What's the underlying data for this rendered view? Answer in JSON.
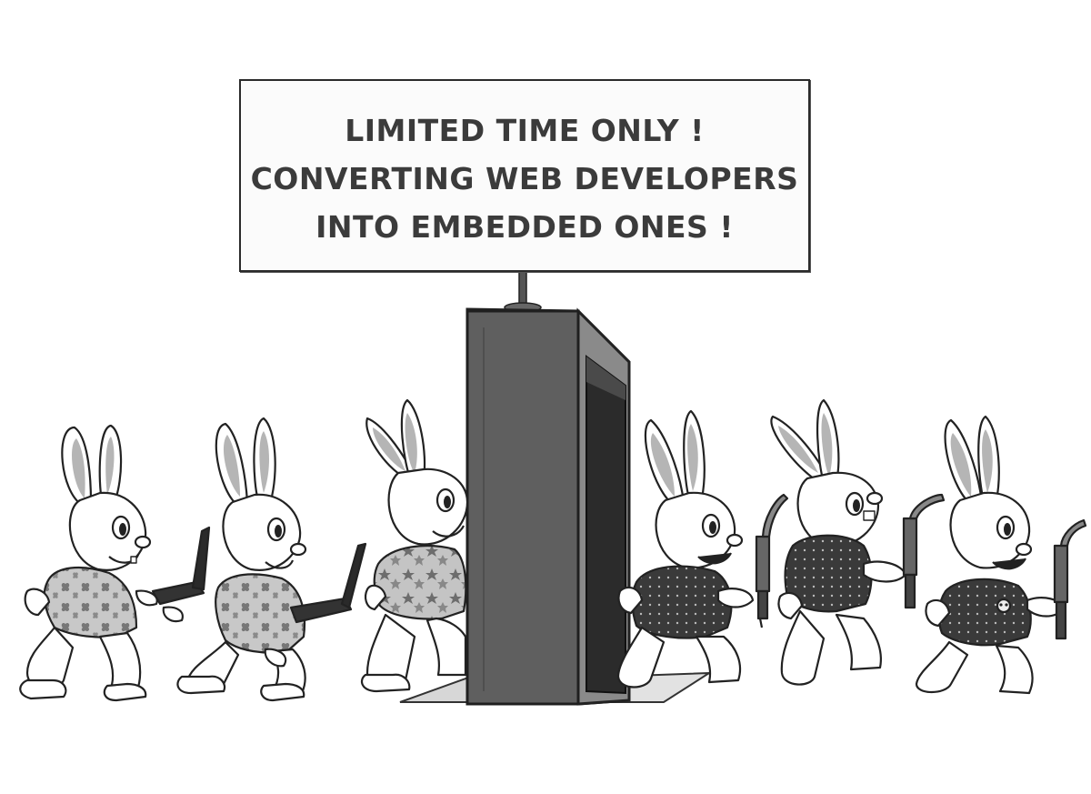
{
  "sign": {
    "lines": [
      "LIMITED TIME ONLY !",
      "CONVERTING WEB DEVELOPERS",
      "INTO EMBEDDED ONES !"
    ]
  },
  "colors": {
    "ink": "#222222",
    "machine": "#5a5a5a",
    "machine_dark": "#3a3a3a",
    "fur": "#ffffff",
    "ear_inner": "#b5b5b5",
    "shirt": "#9a9a9a",
    "vest": "#333333"
  }
}
